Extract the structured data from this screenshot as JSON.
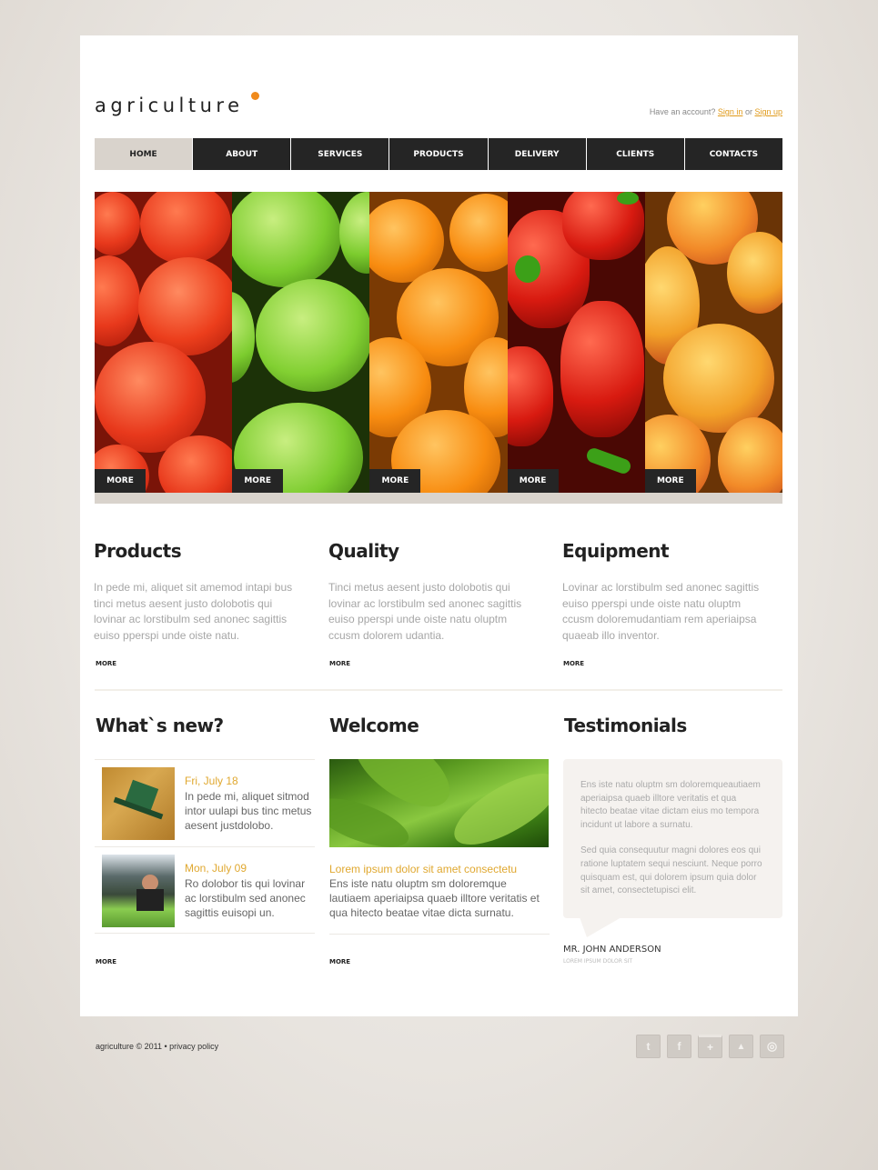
{
  "logo": {
    "text": "agriculture"
  },
  "account": {
    "prompt": "Have an account?",
    "sign_in": "Sign in",
    "or": "or",
    "sign_up": "Sign up"
  },
  "nav": {
    "items": [
      {
        "label": "HOME",
        "active": true
      },
      {
        "label": "ABOUT"
      },
      {
        "label": "SERVICES"
      },
      {
        "label": "PRODUCTS"
      },
      {
        "label": "DELIVERY"
      },
      {
        "label": "CLIENTS"
      },
      {
        "label": "CONTACTS"
      }
    ]
  },
  "slider": {
    "slides": [
      {
        "name": "tomatoes",
        "more": "MORE",
        "color": "#e8391c"
      },
      {
        "name": "apples",
        "more": "MORE",
        "color": "#7ccc2e"
      },
      {
        "name": "oranges",
        "more": "MORE",
        "color": "#f88c10"
      },
      {
        "name": "peppers",
        "more": "MORE",
        "color": "#d81a10"
      },
      {
        "name": "peaches",
        "more": "MORE",
        "color": "#f2a028"
      }
    ]
  },
  "features": [
    {
      "title": "Products",
      "text": "In pede mi, aliquet sit amemod intapi bus tinci metus aesent justo dolobotis qui lovinar ac lorstibulm sed anonec sagittis euiso pperspi unde oiste natu.",
      "more": "MORE"
    },
    {
      "title": "Quality",
      "text": "Tinci metus aesent justo dolobotis qui lovinar ac lorstibulm sed anonec sagittis euiso pperspi unde oiste natu oluptm ccusm dolorem udantia.",
      "more": "MORE"
    },
    {
      "title": "Equipment",
      "text": "Lovinar ac lorstibulm sed anonec sagittis euiso pperspi unde oiste natu oluptm ccusm doloremudantiam rem aperiaipsa quaeab illo inventor.",
      "more": "MORE"
    }
  ],
  "whats_new": {
    "title": "What`s new?",
    "items": [
      {
        "date": "Fri, July 18",
        "text": "In pede mi, aliquet sitmod intor uulapi bus tinc metus aesent justdolobo."
      },
      {
        "date": "Mon, July 09",
        "text": "Ro dolobor tis qui lovinar ac lorstibulm sed anonec sagittis euisopi un."
      }
    ],
    "more": "MORE"
  },
  "welcome": {
    "title": "Welcome",
    "subtitle": "Lorem ipsum dolor sit amet consectetu",
    "text": "Ens iste natu oluptm sm doloremque lautiaem aperiaipsa quaeb illtore veritatis et qua hitecto beatae vitae dicta surnatu.",
    "more": "MORE"
  },
  "testimonials": {
    "title": "Testimonials",
    "paragraphs": [
      "Ens iste natu oluptm sm doloremqueautiaem aperiaipsa quaeb illtore veritatis et qua hitecto beatae vitae dictam eius mo tempora incidunt ut labore a surnatu.",
      "Sed quia consequutur magni dolores eos qui ratione luptatem sequi nesciunt. Neque porro quisquam est, qui dolorem ipsum quia dolor sit amet, consectetupisci elit."
    ],
    "author": "MR. JOHN ANDERSON",
    "author_role": "LOREM IPSUM DOLOR SIT"
  },
  "footer": {
    "copyright": "agriculture © 2011 • privacy policy",
    "social": [
      {
        "name": "twitter-icon",
        "glyph": "t"
      },
      {
        "name": "facebook-icon",
        "glyph": "f"
      },
      {
        "name": "google-plus-icon",
        "glyph": "+"
      },
      {
        "name": "forrst-icon",
        "glyph": "▲"
      },
      {
        "name": "dribbble-icon",
        "glyph": "◎"
      }
    ]
  },
  "colors": {
    "accent": "#f08a1c",
    "nav_bg": "#252525",
    "nav_active": "#d9d3cc",
    "date": "#e0a830"
  }
}
